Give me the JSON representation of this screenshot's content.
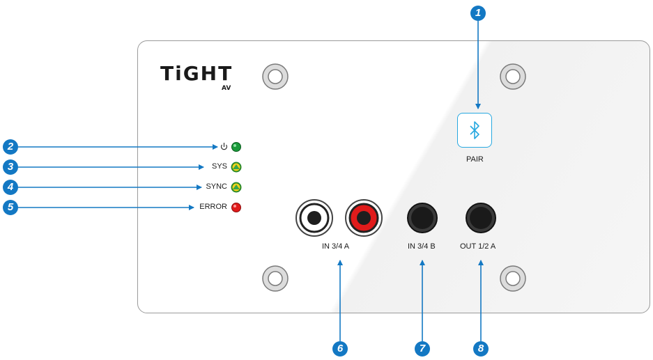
{
  "logo": {
    "main": "TiGHT",
    "sub": "AV"
  },
  "bluetooth": {
    "label": "PAIR",
    "icon": "bluetooth-icon"
  },
  "leds": [
    {
      "label": "",
      "icon": "power-icon",
      "color": "#1a9a3a"
    },
    {
      "label": "SYS",
      "color": "#f2d21a"
    },
    {
      "label": "SYNC",
      "color": "#f2d21a"
    },
    {
      "label": "ERROR",
      "color": "#e01b1b"
    }
  ],
  "ports": [
    {
      "label": "IN 3/4 A"
    },
    {
      "label": "IN 3/4 B"
    },
    {
      "label": "OUT 1/2 A"
    }
  ],
  "callouts": [
    "1",
    "2",
    "3",
    "4",
    "5",
    "6",
    "7",
    "8"
  ],
  "colors": {
    "accent": "#1378c3",
    "bluetooth": "#27a8e0",
    "red_jack": "#e01b1b"
  }
}
